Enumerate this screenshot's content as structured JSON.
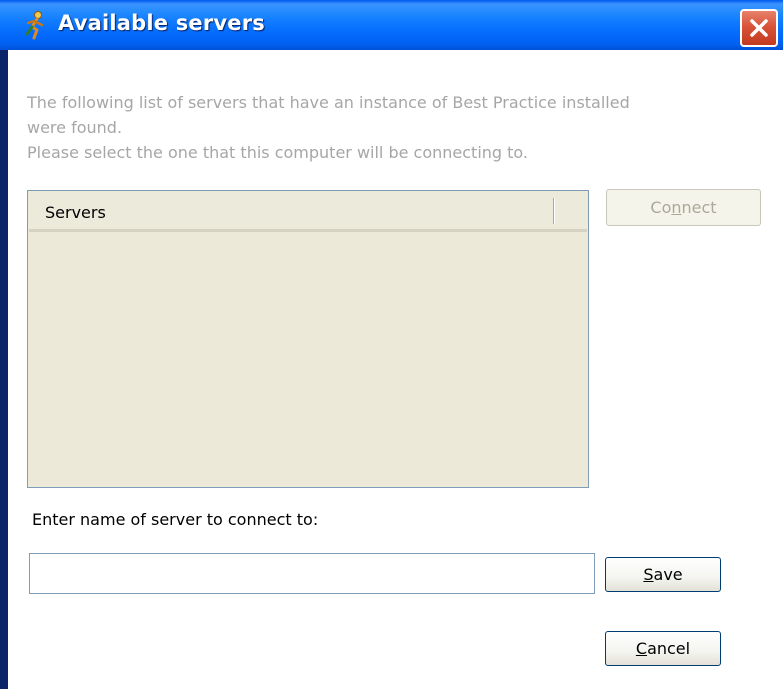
{
  "window": {
    "title": "Available servers",
    "close_label": "×"
  },
  "info": {
    "line1": "The following list of servers that have an instance of Best Practice installed",
    "line2": "were found.",
    "line3": "Please select the one that this computer will be connecting to."
  },
  "server_list": {
    "column_header": "Servers",
    "rows": []
  },
  "buttons": {
    "connect": {
      "label_pre": "Co",
      "label_mnemonic": "n",
      "label_post": "nect",
      "enabled": false
    },
    "save": {
      "label_pre": "",
      "label_mnemonic": "S",
      "label_post": "ave"
    },
    "cancel": {
      "label_pre": "",
      "label_mnemonic": "C",
      "label_post": "ancel"
    }
  },
  "manual_entry": {
    "prompt": "Enter name of server to connect to:",
    "value": "",
    "placeholder": ""
  },
  "icons": {
    "app": "runner-icon",
    "close": "close-icon"
  },
  "colors": {
    "titlebar": "#0058ee",
    "close": "#d8533a",
    "info_text": "#a6a6a6",
    "list_bg": "#ece9d8"
  }
}
